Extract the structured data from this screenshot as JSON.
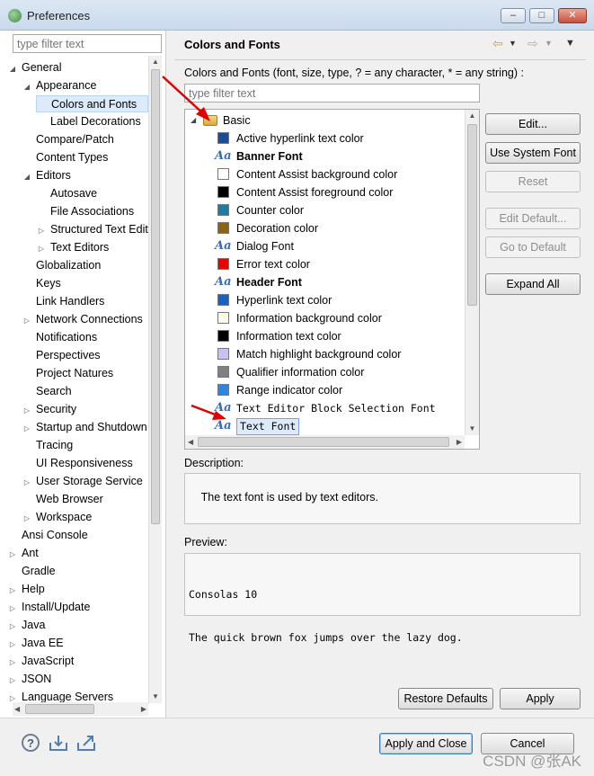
{
  "window": {
    "title": "Preferences",
    "min_glyph": "–",
    "max_glyph": "□",
    "close_glyph": "✕"
  },
  "left": {
    "filter_placeholder": "type filter text",
    "tree": [
      {
        "label": "General",
        "level": 0,
        "twisty": "expanded"
      },
      {
        "label": "Appearance",
        "level": 1,
        "twisty": "expanded"
      },
      {
        "label": "Colors and Fonts",
        "level": 2,
        "twisty": "none",
        "selected": true
      },
      {
        "label": "Label Decorations",
        "level": 2,
        "twisty": "none"
      },
      {
        "label": "Compare/Patch",
        "level": 1,
        "twisty": "none"
      },
      {
        "label": "Content Types",
        "level": 1,
        "twisty": "none"
      },
      {
        "label": "Editors",
        "level": 1,
        "twisty": "expanded"
      },
      {
        "label": "Autosave",
        "level": 2,
        "twisty": "none"
      },
      {
        "label": "File Associations",
        "level": 2,
        "twisty": "none"
      },
      {
        "label": "Structured Text Editors",
        "level": 2,
        "twisty": "collapsed"
      },
      {
        "label": "Text Editors",
        "level": 2,
        "twisty": "collapsed"
      },
      {
        "label": "Globalization",
        "level": 1,
        "twisty": "none"
      },
      {
        "label": "Keys",
        "level": 1,
        "twisty": "none"
      },
      {
        "label": "Link Handlers",
        "level": 1,
        "twisty": "none"
      },
      {
        "label": "Network Connections",
        "level": 1,
        "twisty": "collapsed"
      },
      {
        "label": "Notifications",
        "level": 1,
        "twisty": "none"
      },
      {
        "label": "Perspectives",
        "level": 1,
        "twisty": "none"
      },
      {
        "label": "Project Natures",
        "level": 1,
        "twisty": "none"
      },
      {
        "label": "Search",
        "level": 1,
        "twisty": "none"
      },
      {
        "label": "Security",
        "level": 1,
        "twisty": "collapsed"
      },
      {
        "label": "Startup and Shutdown",
        "level": 1,
        "twisty": "collapsed"
      },
      {
        "label": "Tracing",
        "level": 1,
        "twisty": "none"
      },
      {
        "label": "UI Responsiveness",
        "level": 1,
        "twisty": "none"
      },
      {
        "label": "User Storage Service",
        "level": 1,
        "twisty": "collapsed"
      },
      {
        "label": "Web Browser",
        "level": 1,
        "twisty": "none"
      },
      {
        "label": "Workspace",
        "level": 1,
        "twisty": "collapsed"
      },
      {
        "label": "Ansi Console",
        "level": 0,
        "twisty": "none"
      },
      {
        "label": "Ant",
        "level": 0,
        "twisty": "collapsed"
      },
      {
        "label": "Gradle",
        "level": 0,
        "twisty": "none"
      },
      {
        "label": "Help",
        "level": 0,
        "twisty": "collapsed"
      },
      {
        "label": "Install/Update",
        "level": 0,
        "twisty": "collapsed"
      },
      {
        "label": "Java",
        "level": 0,
        "twisty": "collapsed"
      },
      {
        "label": "Java EE",
        "level": 0,
        "twisty": "collapsed"
      },
      {
        "label": "JavaScript",
        "level": 0,
        "twisty": "collapsed"
      },
      {
        "label": "JSON",
        "level": 0,
        "twisty": "collapsed"
      },
      {
        "label": "Language Servers",
        "level": 0,
        "twisty": "collapsed"
      }
    ]
  },
  "right": {
    "header": "Colors and Fonts",
    "description": "Colors and Fonts (font, size, type, ? = any character, * = any string) :",
    "filter_placeholder": "type filter text",
    "category": "Basic",
    "items": [
      {
        "label": "Active hyperlink text color",
        "kind": "color",
        "color": "#1a4e94"
      },
      {
        "label": "Banner Font",
        "kind": "font",
        "bold": true
      },
      {
        "label": "Content Assist background color",
        "kind": "color",
        "color": "#ffffff"
      },
      {
        "label": "Content Assist foreground color",
        "kind": "color",
        "color": "#000000"
      },
      {
        "label": "Counter color",
        "kind": "color",
        "color": "#1f7ba0"
      },
      {
        "label": "Decoration color",
        "kind": "color",
        "color": "#8a6410"
      },
      {
        "label": "Dialog Font",
        "kind": "font"
      },
      {
        "label": "Error text color",
        "kind": "color",
        "color": "#ee0000"
      },
      {
        "label": "Header Font",
        "kind": "font",
        "bold": true
      },
      {
        "label": "Hyperlink text color",
        "kind": "color",
        "color": "#1a62c0"
      },
      {
        "label": "Information background color",
        "kind": "color",
        "color": "#fbfbe6"
      },
      {
        "label": "Information text color",
        "kind": "color",
        "color": "#000000"
      },
      {
        "label": "Match highlight background color",
        "kind": "color",
        "color": "#c7c2f2"
      },
      {
        "label": "Qualifier information color",
        "kind": "color",
        "color": "#808080"
      },
      {
        "label": "Range indicator color",
        "kind": "color",
        "color": "#2a86e0"
      },
      {
        "label": "Text Editor Block Selection Font",
        "kind": "font",
        "mono": true
      },
      {
        "label": "Text Font",
        "kind": "font",
        "mono": true,
        "selected": true
      }
    ],
    "buttons": {
      "edit": "Edit...",
      "use_system_font": "Use System Font",
      "reset": "Reset",
      "edit_default": "Edit Default...",
      "go_to_default": "Go to Default",
      "expand_all": "Expand All"
    },
    "description_label": "Description:",
    "description_text": "The text font is used by text editors.",
    "preview_label": "Preview:",
    "preview_lines": [
      "Consolas 10",
      "The quick brown fox jumps over the lazy dog."
    ],
    "restore_defaults": "Restore Defaults",
    "apply": "Apply"
  },
  "footer": {
    "apply_and_close": "Apply and Close",
    "cancel": "Cancel",
    "help_glyph": "?",
    "watermark": "CSDN @张AK"
  },
  "icons": [
    "help-icon",
    "import-icon",
    "export-icon",
    "back-icon",
    "forward-icon",
    "menu-icon",
    "font-icon",
    "color-swatch-icon",
    "folder-icon"
  ]
}
